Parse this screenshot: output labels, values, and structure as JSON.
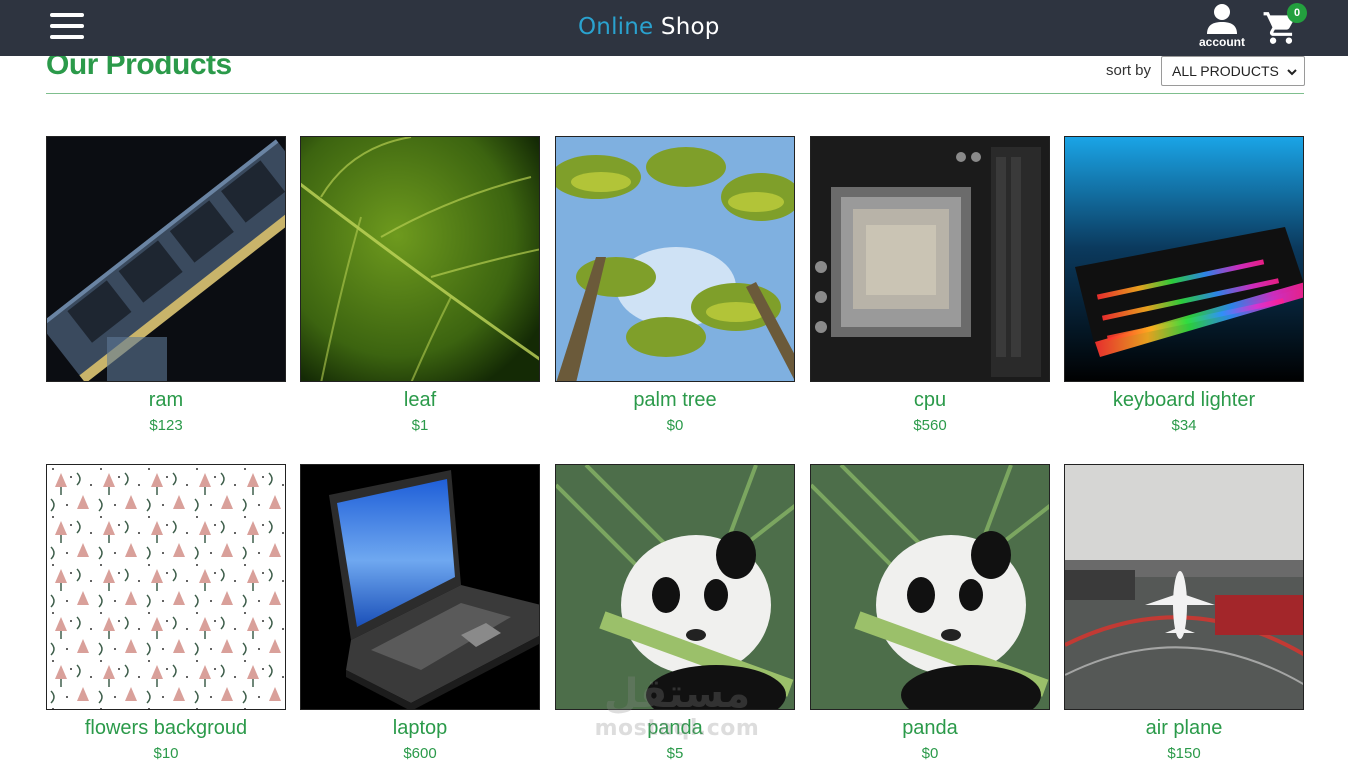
{
  "navbar": {
    "brand_part1": "Online",
    "brand_part2": "Shop",
    "account_label": "account",
    "cart_count": "0"
  },
  "page": {
    "title": "Our Products",
    "sort_label": "sort by",
    "sort_selected": "ALL PRODUCTS"
  },
  "products": [
    {
      "name": "ram",
      "price": "$123",
      "image": "ram-module-photo"
    },
    {
      "name": "leaf",
      "price": "$1",
      "image": "green-leaf-photo"
    },
    {
      "name": "palm tree",
      "price": "$0",
      "image": "palm-trees-photo"
    },
    {
      "name": "cpu",
      "price": "$560",
      "image": "cpu-socket-photo"
    },
    {
      "name": "keyboard lighter",
      "price": "$34",
      "image": "rgb-keyboard-photo"
    },
    {
      "name": "flowers backgroud",
      "price": "$10",
      "image": "floral-pattern"
    },
    {
      "name": "laptop",
      "price": "$600",
      "image": "laptop-illustration"
    },
    {
      "name": "panda",
      "price": "$5",
      "image": "panda-photo"
    },
    {
      "name": "panda",
      "price": "$0",
      "image": "panda-photo"
    },
    {
      "name": "air plane",
      "price": "$150",
      "image": "airport-plane-photo"
    }
  ],
  "watermark": {
    "arabic": "مستقل",
    "latin": "mostaql.com"
  },
  "colors": {
    "navbar_bg": "#2e3440",
    "accent_green": "#2b9a4a",
    "brand_blue": "#2aa2cf",
    "badge_green": "#23a03e"
  },
  "icons": [
    "hamburger-menu-icon",
    "account-icon",
    "cart-icon",
    "chevron-down-icon"
  ]
}
